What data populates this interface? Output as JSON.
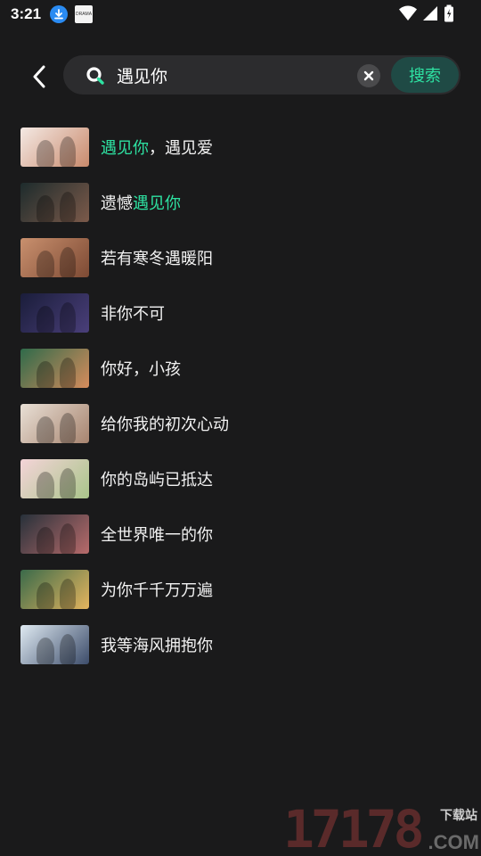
{
  "status_bar": {
    "time": "3:21",
    "app_icon_text": "DRAMA"
  },
  "search": {
    "query": "遇见你",
    "placeholder": "",
    "button_label": "搜索"
  },
  "colors": {
    "accent": "#2ee2a2",
    "background": "#1a1a1b",
    "search_bg": "#2c2c2e"
  },
  "results": [
    {
      "segments": [
        {
          "t": "遇见你",
          "hl": true
        },
        {
          "t": "，遇见爱",
          "hl": false
        }
      ],
      "thumb": [
        "#f4e9e4",
        "#c98a6c"
      ]
    },
    {
      "segments": [
        {
          "t": "遗憾",
          "hl": false
        },
        {
          "t": "遇见你",
          "hl": true
        }
      ],
      "thumb": [
        "#1d2b2c",
        "#7c5a4a"
      ]
    },
    {
      "segments": [
        {
          "t": "若有寒冬遇暖阳",
          "hl": false
        }
      ],
      "thumb": [
        "#c9906e",
        "#7d4a34"
      ]
    },
    {
      "segments": [
        {
          "t": "非你不可",
          "hl": false
        }
      ],
      "thumb": [
        "#1a1d3a",
        "#4a3f7a"
      ]
    },
    {
      "segments": [
        {
          "t": "你好，小孩",
          "hl": false
        }
      ],
      "thumb": [
        "#2f6a4a",
        "#d68c5c"
      ]
    },
    {
      "segments": [
        {
          "t": "给你我的初次心动",
          "hl": false
        }
      ],
      "thumb": [
        "#e9e0d6",
        "#a7846f"
      ]
    },
    {
      "segments": [
        {
          "t": "你的岛屿已抵达",
          "hl": false
        }
      ],
      "thumb": [
        "#f4d4d8",
        "#a9c58a"
      ]
    },
    {
      "segments": [
        {
          "t": "全世界唯一的你",
          "hl": false
        }
      ],
      "thumb": [
        "#27313a",
        "#b86b6b"
      ]
    },
    {
      "segments": [
        {
          "t": "为你千千万万遍",
          "hl": false
        }
      ],
      "thumb": [
        "#3a6a4a",
        "#e4b45e"
      ]
    },
    {
      "segments": [
        {
          "t": "我等海风拥抱你",
          "hl": false
        }
      ],
      "thumb": [
        "#dfeaf2",
        "#3c4c6a"
      ]
    }
  ],
  "watermark": {
    "number": "17178",
    "tag": "下载站",
    "domain": ".COM"
  }
}
